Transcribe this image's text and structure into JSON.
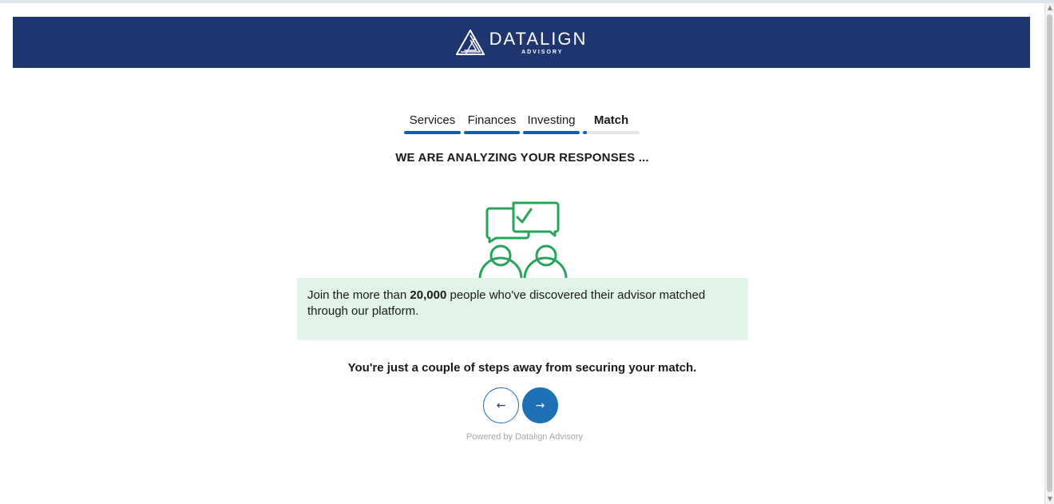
{
  "header": {
    "brand_name": "DATALIGN",
    "brand_sub": "ADVISORY",
    "background": "#1f3570"
  },
  "progress": {
    "steps": [
      {
        "label": "Services",
        "complete": true
      },
      {
        "label": "Finances",
        "complete": true
      },
      {
        "label": "Investing",
        "complete": true
      },
      {
        "label": "Match",
        "complete": false,
        "active": true
      }
    ],
    "accent": "#0e5fb4"
  },
  "main": {
    "heading": "WE ARE ANALYZING YOUR RESPONSES ...",
    "illustration_icon": "people-chat-check-icon",
    "info": {
      "prefix": "Join the more than ",
      "highlight": "20,000",
      "suffix": " people who've discovered their advisor matched through our platform.",
      "background": "#e0f4e7"
    },
    "steps_away": "You're just a couple of steps away from securing your match.",
    "back_icon": "←",
    "next_icon": "→",
    "powered_by": "Powered by Datalign Advisory"
  }
}
